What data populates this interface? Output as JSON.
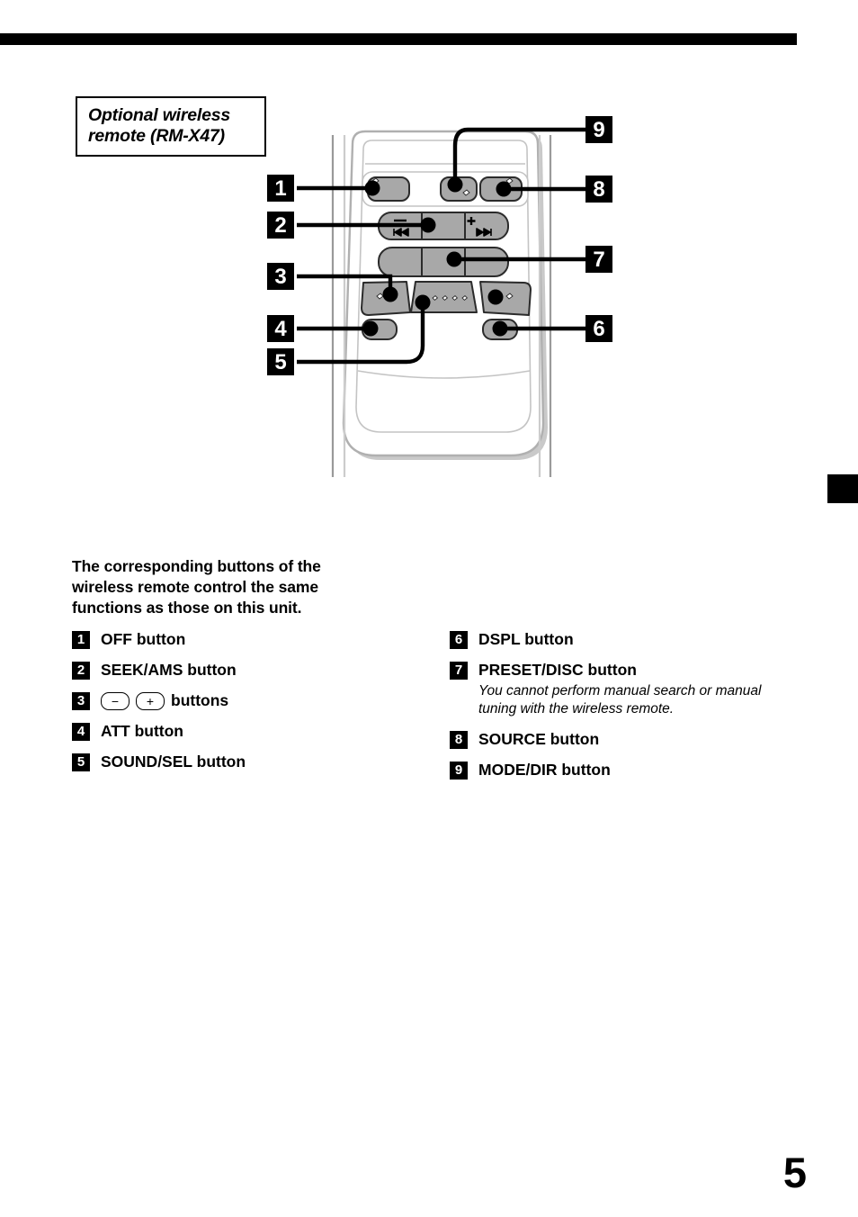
{
  "page": {
    "number": "5"
  },
  "title_box": {
    "line1": "Optional wireless",
    "line2": "remote (RM-X47)"
  },
  "diagram": {
    "alt": "Optional wireless remote RM-X47 with numbered callouts 1 through 9",
    "callouts": [
      {
        "id": "1",
        "side": "left"
      },
      {
        "id": "2",
        "side": "left"
      },
      {
        "id": "3",
        "side": "left"
      },
      {
        "id": "4",
        "side": "left"
      },
      {
        "id": "5",
        "side": "left"
      },
      {
        "id": "6",
        "side": "right"
      },
      {
        "id": "7",
        "side": "right"
      },
      {
        "id": "8",
        "side": "right"
      },
      {
        "id": "9",
        "side": "right"
      }
    ],
    "button_symbols": {
      "seek_minus": "−",
      "seek_minus_icon": "◀◀",
      "seek_plus": "+",
      "seek_plus_icon": "▶▶"
    },
    "colors": {
      "button_fill": "#a8a8a8",
      "button_edge": "#2b2b2b",
      "body_edge": "#b5b5b5",
      "body_fill": "#ffffff",
      "leader": "#000000"
    }
  },
  "legend": {
    "intro": "The corresponding buttons of the wireless remote control the same functions as those on this unit.",
    "left_items": [
      {
        "num": "1",
        "label": "OFF button"
      },
      {
        "num": "2",
        "label": "SEEK/AMS button"
      },
      {
        "num": "3",
        "label": "buttons",
        "minus": "−",
        "plus": "+"
      },
      {
        "num": "4",
        "label": "ATT button"
      },
      {
        "num": "5",
        "label": "SOUND/SEL button"
      }
    ],
    "right_items": [
      {
        "num": "6",
        "label": "DSPL button"
      },
      {
        "num": "7",
        "label": "PRESET/DISC button",
        "note": "You cannot perform manual search or manual tuning with the wireless remote."
      },
      {
        "num": "8",
        "label": "SOURCE button"
      },
      {
        "num": "9",
        "label": "MODE/DIR button"
      }
    ]
  }
}
